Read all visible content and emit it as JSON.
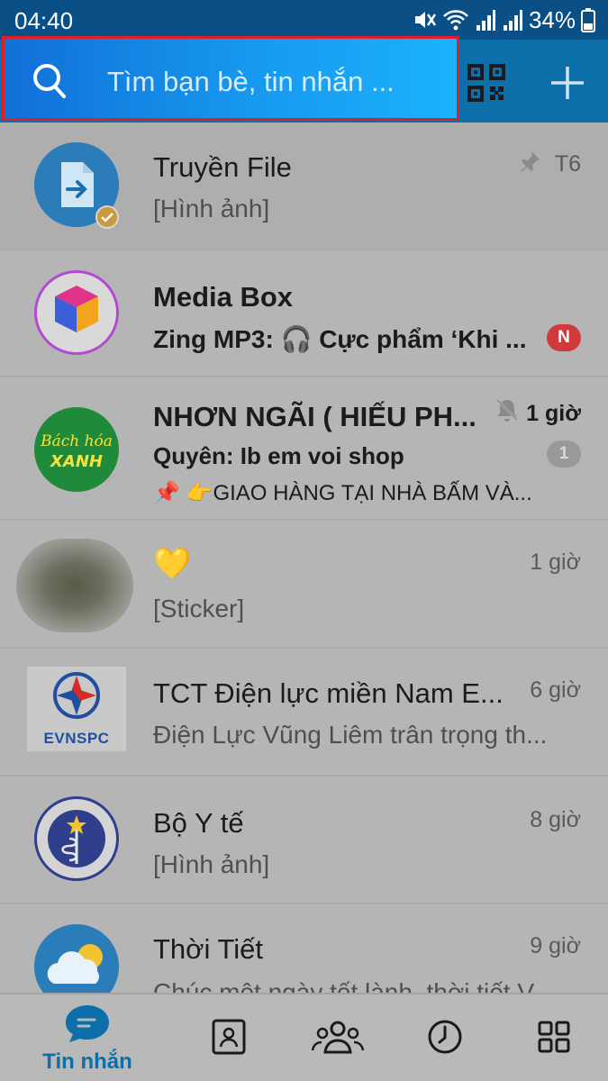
{
  "status": {
    "time": "04:40",
    "battery": "34%"
  },
  "search": {
    "placeholder": "Tìm bạn bè, tin nhắn ..."
  },
  "conversations": [
    {
      "name": "Truyền File",
      "preview": "[Hình ảnh]",
      "time": "T6"
    },
    {
      "name": "Media Box",
      "preview": "Zing MP3: 🎧 Cực phẩm ‘Khi ...",
      "badge": "N"
    },
    {
      "name": "NHƠN NGÃI ( HIẾU PH...",
      "time": "1 giờ",
      "preview": "Quyên: Ib em voi shop",
      "preview2": "GIAO HÀNG TẠI NHÀ BẤM VÀ...",
      "badge": "1",
      "avatar_text1": "Bách hóa",
      "avatar_text2": "XANH"
    },
    {
      "name": "💛",
      "preview": "[Sticker]",
      "time": "1 giờ"
    },
    {
      "name": "TCT Điện lực miền Nam E...",
      "preview": "Điện Lực Vũng Liêm trân trọng th...",
      "time": "6 giờ",
      "avatar_text": "EVNSPC"
    },
    {
      "name": "Bộ Y tế",
      "preview": "[Hình ảnh]",
      "time": "8 giờ"
    },
    {
      "name": "Thời Tiết",
      "preview": "Chúc một ngày tốt lành, thời tiết V...",
      "time": "9 giờ"
    }
  ],
  "nav": {
    "messages_label": "Tin nhắn"
  },
  "colors": {
    "header": "#0d6fa9",
    "search_highlight": "#e11d2a",
    "accent": "#0d6fa9",
    "badge_red": "#d13a3a"
  }
}
